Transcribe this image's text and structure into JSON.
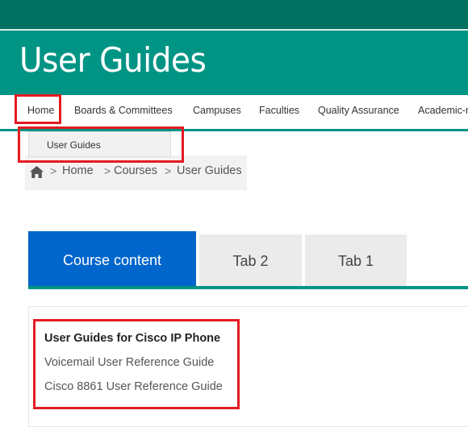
{
  "header": {
    "title": "User Guides"
  },
  "nav": {
    "items": [
      "Home",
      "Boards & Committees",
      "Campuses",
      "Faculties",
      "Quality Assurance",
      "Academic-r"
    ]
  },
  "dropdown": {
    "item": "User Guides"
  },
  "breadcrumb": {
    "items": [
      "Home",
      "Courses",
      "User Guides"
    ],
    "separator": ">"
  },
  "tabs": {
    "items": [
      "Course content",
      "Tab 2",
      "Tab 1"
    ],
    "active": "Course content"
  },
  "content": {
    "title": "User Guides for Cisco IP Phone",
    "links": [
      "Voicemail User Reference Guide",
      "Cisco 8861 User Reference Guide"
    ]
  },
  "colors": {
    "top_bar": "#007161",
    "header": "#009485",
    "active_tab": "#0066cc",
    "highlight": "#e31b23"
  },
  "icons": {
    "breadcrumb_home": "home-icon"
  }
}
